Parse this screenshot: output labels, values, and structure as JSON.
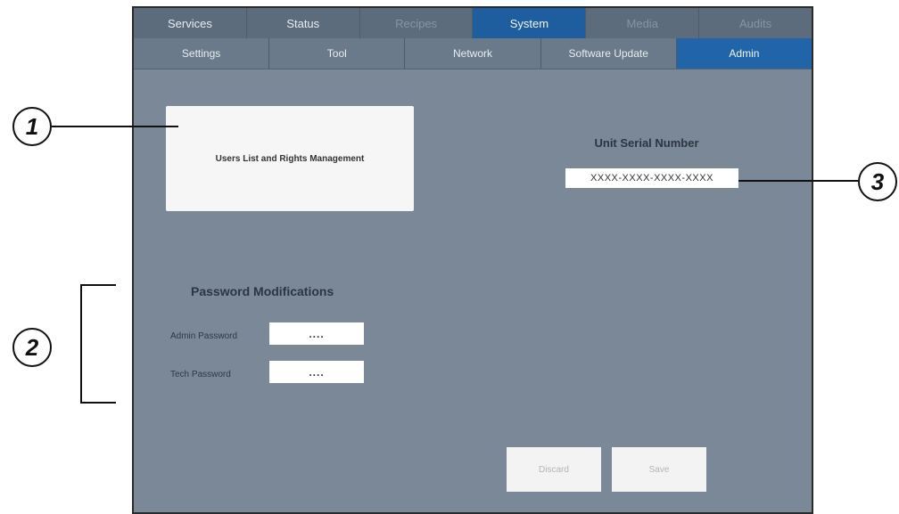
{
  "primary_tabs": [
    {
      "label": "Services",
      "state": "normal"
    },
    {
      "label": "Status",
      "state": "normal"
    },
    {
      "label": "Recipes",
      "state": "disabled"
    },
    {
      "label": "System",
      "state": "active"
    },
    {
      "label": "Media",
      "state": "disabled"
    },
    {
      "label": "Audits",
      "state": "disabled"
    }
  ],
  "secondary_tabs": [
    {
      "label": "Settings",
      "state": "normal"
    },
    {
      "label": "Tool",
      "state": "normal"
    },
    {
      "label": "Network",
      "state": "normal"
    },
    {
      "label": "Software Update",
      "state": "normal"
    },
    {
      "label": "Admin",
      "state": "active"
    }
  ],
  "users_card": {
    "label": "Users List and Rights Management"
  },
  "serial": {
    "label": "Unit Serial Number",
    "value": "XXXX-XXXX-XXXX-XXXX"
  },
  "password": {
    "title": "Password Modifications",
    "admin_label": "Admin Password",
    "admin_value": "....",
    "tech_label": "Tech Password",
    "tech_value": "...."
  },
  "buttons": {
    "discard": "Discard",
    "save": "Save"
  },
  "callouts": {
    "one": "1",
    "two": "2",
    "three": "3"
  },
  "colors": {
    "active_tab": "#1f5e9e",
    "panel_bg": "#7a8898",
    "disabled_text": "#8794a2"
  }
}
